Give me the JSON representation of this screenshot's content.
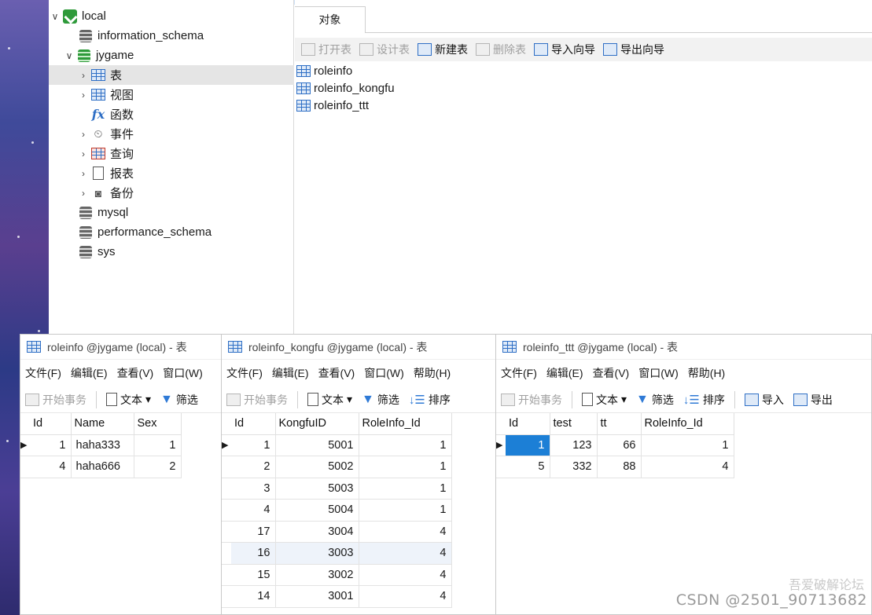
{
  "tree": {
    "items": [
      {
        "label": "local",
        "icon": "connection-icon"
      },
      {
        "label": "information_schema",
        "icon": "database-icon"
      },
      {
        "label": "jygame",
        "icon": "database-open-icon"
      },
      {
        "label": "表",
        "icon": "table-icon"
      },
      {
        "label": "视图",
        "icon": "view-icon"
      },
      {
        "label": "函数",
        "icon": "function-icon"
      },
      {
        "label": "事件",
        "icon": "event-clock-icon"
      },
      {
        "label": "查询",
        "icon": "query-icon"
      },
      {
        "label": "报表",
        "icon": "report-icon"
      },
      {
        "label": "备份",
        "icon": "backup-icon"
      },
      {
        "label": "mysql",
        "icon": "database-icon"
      },
      {
        "label": "performance_schema",
        "icon": "database-icon"
      },
      {
        "label": "sys",
        "icon": "database-icon"
      }
    ]
  },
  "objects": {
    "tab_label": "对象",
    "toolbar": {
      "open": "打开表",
      "design": "设计表",
      "new": "新建表",
      "delete": "删除表",
      "import": "导入向导",
      "export": "导出向导"
    },
    "tables": [
      "roleinfo",
      "roleinfo_kongfu",
      "roleinfo_ttt"
    ]
  },
  "menus": {
    "file": "文件(F)",
    "edit": "编辑(E)",
    "view": "查看(V)",
    "window": "窗口(W)",
    "help": "帮助(H)"
  },
  "tools": {
    "begin_tx": "开始事务",
    "text": "文本",
    "filter": "筛选",
    "sort": "排序",
    "import": "导入",
    "export": "导出"
  },
  "windows": [
    {
      "title": "roleinfo @jygame (local) - 表",
      "columns": [
        "Id",
        "Name",
        "Sex"
      ],
      "rows": [
        [
          "1",
          "haha333",
          "1"
        ],
        [
          "4",
          "haha666",
          "2"
        ]
      ]
    },
    {
      "title": "roleinfo_kongfu @jygame (local) - 表",
      "columns": [
        "Id",
        "KongfuID",
        "RoleInfo_Id"
      ],
      "rows": [
        [
          "1",
          "5001",
          "1"
        ],
        [
          "2",
          "5002",
          "1"
        ],
        [
          "3",
          "5003",
          "1"
        ],
        [
          "4",
          "5004",
          "1"
        ],
        [
          "17",
          "3004",
          "4"
        ],
        [
          "16",
          "3003",
          "4"
        ],
        [
          "15",
          "3002",
          "4"
        ],
        [
          "14",
          "3001",
          "4"
        ]
      ]
    },
    {
      "title": "roleinfo_ttt @jygame (local) - 表",
      "columns": [
        "Id",
        "test",
        "tt",
        "RoleInfo_Id"
      ],
      "rows": [
        [
          "1",
          "123",
          "66",
          "1"
        ],
        [
          "5",
          "332",
          "88",
          "4"
        ]
      ]
    }
  ],
  "watermark": {
    "line1": "吾爱破解论坛",
    "line2": "CSDN @2501_90713682"
  }
}
